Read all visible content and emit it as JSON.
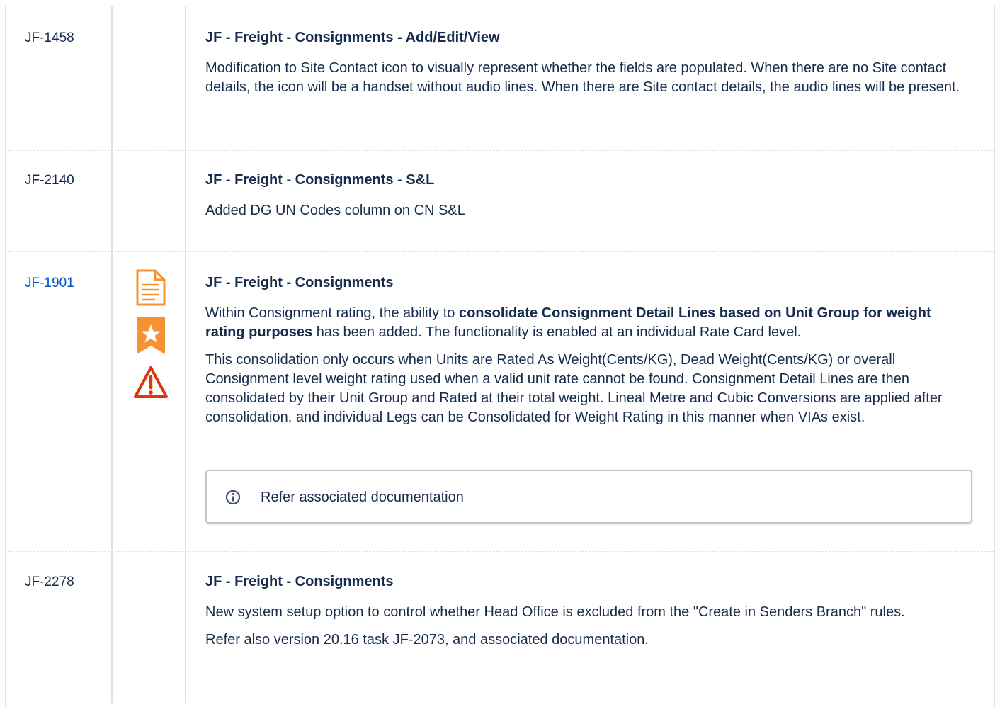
{
  "rows": [
    {
      "id": "JF-1458",
      "title": "JF - Freight - Consignments - Add/Edit/View",
      "body": "Modification to Site Contact icon to visually represent whether the fields are populated. When there are no Site contact details, the icon will be a handset without audio lines. When there are Site contact details, the audio lines will be present."
    },
    {
      "id": "JF-2140",
      "title": "JF - Freight - Consignments - S&L",
      "body": "Added DG UN Codes column on CN S&L"
    },
    {
      "id": "JF-1901",
      "title": "JF - Freight - Consignments",
      "p1_pre": "Within Consignment rating, the ability to ",
      "p1_bold": "consolidate Consignment Detail Lines based on Unit Group for weight rating purposes",
      "p1_post": " has been added. The functionality is enabled at an individual Rate Card level.",
      "p2": "This consolidation only occurs when Units are Rated As Weight(Cents/KG), Dead Weight(Cents/KG) or overall Consignment level weight rating used when a valid unit rate cannot be found. Consignment Detail Lines are then consolidated by their Unit Group and Rated at their total weight. Lineal Metre and Cubic Conversions are applied after consolidation, and individual Legs can be Consolidated for Weight Rating in this manner when VIAs exist.",
      "panel_text": "Refer associated documentation",
      "icons": [
        "document-icon",
        "star-bookmark-icon",
        "warning-icon"
      ]
    },
    {
      "id": "JF-2278",
      "title": "JF - Freight - Consignments",
      "p1": "New system setup option to control whether Head Office is excluded from the \"Create in Senders Branch\" rules.",
      "p2": "Refer also version 20.16 task JF-2073, and associated documentation."
    }
  ],
  "colors": {
    "link": "#0052cc",
    "text": "#172b4d",
    "border": "#dfe1e6",
    "icon_orange": "#f79232",
    "warning_red": "#de350b"
  }
}
